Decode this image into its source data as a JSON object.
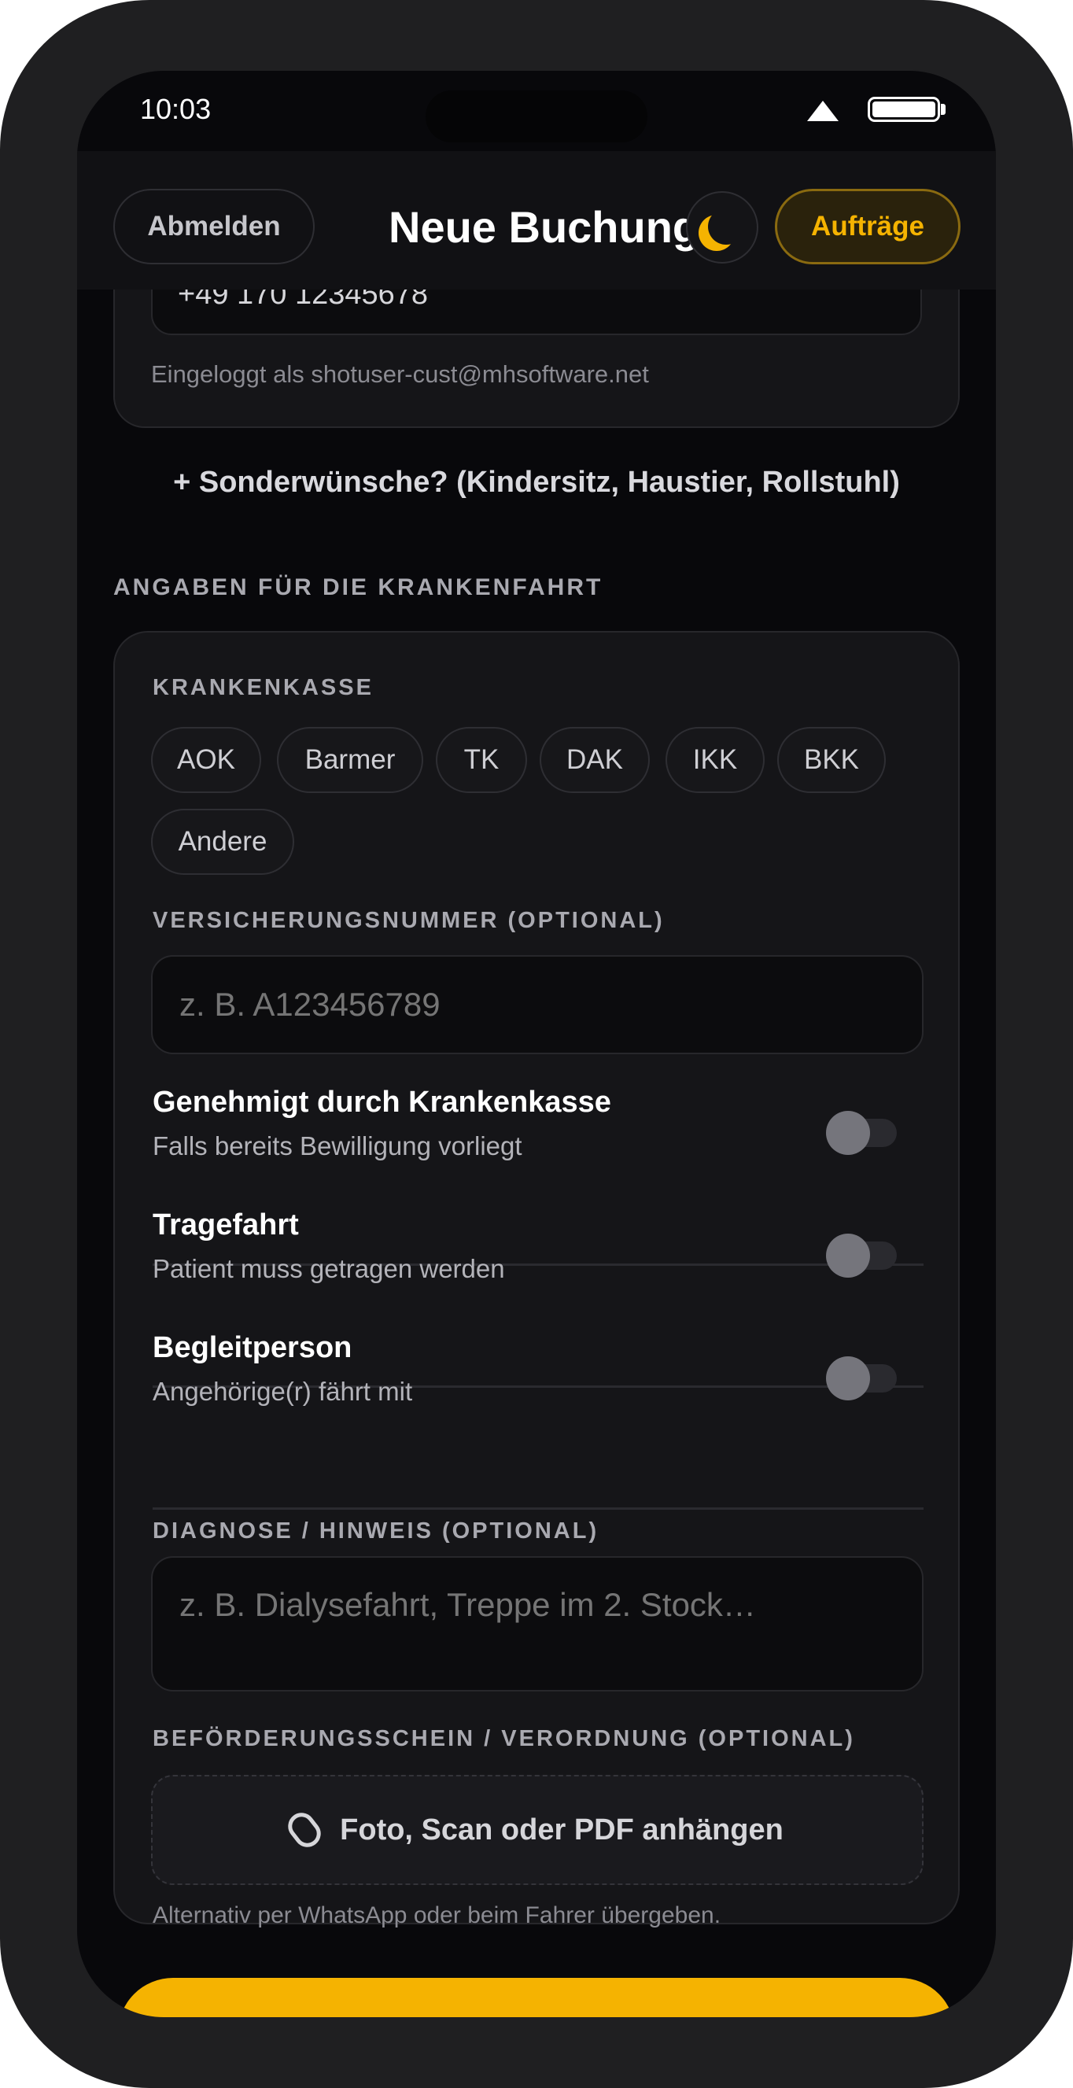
{
  "status_bar": {
    "time": "10:03"
  },
  "header": {
    "logout_label": "Abmelden",
    "title": "Neue Buchung",
    "orders_label": "Aufträge"
  },
  "contact": {
    "phone_value": "+49 170 12345678",
    "login_info": "Eingeloggt als shotuser-cust@mhsoftware.net"
  },
  "special_wishes_label": "+ Sonderwünsche? (Kindersitz, Haustier, Rollstuhl)",
  "section": {
    "heading": "ANGABEN FÜR DIE KRANKENFAHRT"
  },
  "insurance": {
    "label": "KRANKENKASSE",
    "options": [
      "AOK",
      "Barmer",
      "TK",
      "DAK",
      "IKK",
      "BKK",
      "Andere"
    ]
  },
  "insurance_number": {
    "label": "VERSICHERUNGSNUMMER (OPTIONAL)",
    "placeholder": "z. B. A123456789"
  },
  "toggles": [
    {
      "title": "Genehmigt durch Krankenkasse",
      "subtitle": "Falls bereits Bewilligung vorliegt",
      "on": false
    },
    {
      "title": "Tragefahrt",
      "subtitle": "Patient muss getragen werden",
      "on": false
    },
    {
      "title": "Begleitperson",
      "subtitle": "Angehörige(r) fährt mit",
      "on": false
    }
  ],
  "diagnosis": {
    "label": "DIAGNOSE / HINWEIS (OPTIONAL)",
    "placeholder": "z. B. Dialysefahrt, Treppe im 2. Stock…"
  },
  "prescription": {
    "label": "BEFÖRDERUNGSSCHEIN / VERORDNUNG (OPTIONAL)",
    "upload_label": "Foto, Scan oder PDF anhängen",
    "hint": "Alternativ per WhatsApp oder beim Fahrer übergeben."
  },
  "colors": {
    "accent": "#f5b301",
    "background": "#08080b",
    "card": "#151518"
  }
}
